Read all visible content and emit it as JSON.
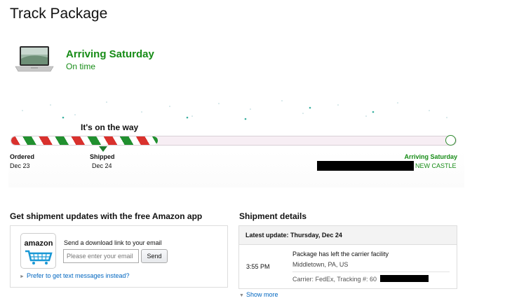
{
  "header": {
    "title": "Track Package"
  },
  "summary": {
    "arriving": "Arriving Saturday",
    "status": "On time"
  },
  "tracker": {
    "caption": "It's on the way",
    "progress": 0.33,
    "steps": [
      {
        "label": "Ordered",
        "date": "Dec 23"
      },
      {
        "label": "Shipped",
        "date": "Dec 24"
      }
    ],
    "destination": {
      "label": "Arriving Saturday",
      "city": "NEW CASTLE"
    },
    "colors": {
      "red": "#d9312d",
      "green": "#21902f",
      "text_green": "#178c17"
    }
  },
  "app_promo": {
    "heading": "Get shipment updates with the free Amazon app",
    "icon_text": "amazon",
    "send_label": "Send a download link to your email",
    "email_placeholder": "Please enter your email",
    "send_button": "Send",
    "text_link": "Prefer to get text messages instead?"
  },
  "shipment": {
    "heading": "Shipment details",
    "latest": "Latest update: Thursday, Dec 24",
    "time": "3:55 PM",
    "event": "Package has left the carrier facility",
    "location": "Middletown, PA, US",
    "carrier": "Carrier: FedEx, Tracking #: 60",
    "show_more": "Show more"
  },
  "icons": {
    "product": "laptop-thumbnail",
    "cart": "shopping-cart-icon",
    "link_caret": "chevron-right-icon"
  }
}
